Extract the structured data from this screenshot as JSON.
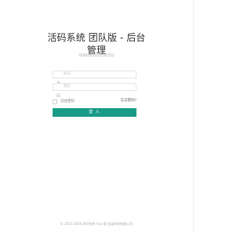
{
  "header": {
    "title": "活码系统 团队版 - 后台管理",
    "subtitle": "快速轻松搭建营销活动"
  },
  "form": {
    "username_placeholder": "账号",
    "password_placeholder": "密码",
    "remember_label": "记住密码",
    "forgot_label": "忘记密码?",
    "login_label": "登 入"
  },
  "footer": {
    "copyright": "© 2015-2018 活码系统 V.xx 版 由某科技有限公司"
  },
  "icons": {
    "username": "user-icon",
    "password": "lock-icon"
  },
  "colors": {
    "accent": "#199b88"
  }
}
